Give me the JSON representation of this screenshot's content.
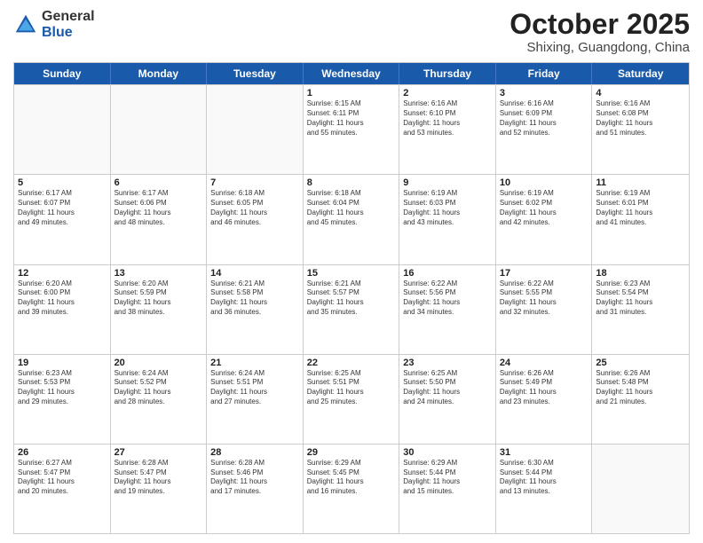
{
  "header": {
    "logo_general": "General",
    "logo_blue": "Blue",
    "month_title": "October 2025",
    "location": "Shixing, Guangdong, China"
  },
  "calendar": {
    "days_of_week": [
      "Sunday",
      "Monday",
      "Tuesday",
      "Wednesday",
      "Thursday",
      "Friday",
      "Saturday"
    ],
    "weeks": [
      [
        {
          "day": "",
          "info": ""
        },
        {
          "day": "",
          "info": ""
        },
        {
          "day": "",
          "info": ""
        },
        {
          "day": "1",
          "info": "Sunrise: 6:15 AM\nSunset: 6:11 PM\nDaylight: 11 hours\nand 55 minutes."
        },
        {
          "day": "2",
          "info": "Sunrise: 6:16 AM\nSunset: 6:10 PM\nDaylight: 11 hours\nand 53 minutes."
        },
        {
          "day": "3",
          "info": "Sunrise: 6:16 AM\nSunset: 6:09 PM\nDaylight: 11 hours\nand 52 minutes."
        },
        {
          "day": "4",
          "info": "Sunrise: 6:16 AM\nSunset: 6:08 PM\nDaylight: 11 hours\nand 51 minutes."
        }
      ],
      [
        {
          "day": "5",
          "info": "Sunrise: 6:17 AM\nSunset: 6:07 PM\nDaylight: 11 hours\nand 49 minutes."
        },
        {
          "day": "6",
          "info": "Sunrise: 6:17 AM\nSunset: 6:06 PM\nDaylight: 11 hours\nand 48 minutes."
        },
        {
          "day": "7",
          "info": "Sunrise: 6:18 AM\nSunset: 6:05 PM\nDaylight: 11 hours\nand 46 minutes."
        },
        {
          "day": "8",
          "info": "Sunrise: 6:18 AM\nSunset: 6:04 PM\nDaylight: 11 hours\nand 45 minutes."
        },
        {
          "day": "9",
          "info": "Sunrise: 6:19 AM\nSunset: 6:03 PM\nDaylight: 11 hours\nand 43 minutes."
        },
        {
          "day": "10",
          "info": "Sunrise: 6:19 AM\nSunset: 6:02 PM\nDaylight: 11 hours\nand 42 minutes."
        },
        {
          "day": "11",
          "info": "Sunrise: 6:19 AM\nSunset: 6:01 PM\nDaylight: 11 hours\nand 41 minutes."
        }
      ],
      [
        {
          "day": "12",
          "info": "Sunrise: 6:20 AM\nSunset: 6:00 PM\nDaylight: 11 hours\nand 39 minutes."
        },
        {
          "day": "13",
          "info": "Sunrise: 6:20 AM\nSunset: 5:59 PM\nDaylight: 11 hours\nand 38 minutes."
        },
        {
          "day": "14",
          "info": "Sunrise: 6:21 AM\nSunset: 5:58 PM\nDaylight: 11 hours\nand 36 minutes."
        },
        {
          "day": "15",
          "info": "Sunrise: 6:21 AM\nSunset: 5:57 PM\nDaylight: 11 hours\nand 35 minutes."
        },
        {
          "day": "16",
          "info": "Sunrise: 6:22 AM\nSunset: 5:56 PM\nDaylight: 11 hours\nand 34 minutes."
        },
        {
          "day": "17",
          "info": "Sunrise: 6:22 AM\nSunset: 5:55 PM\nDaylight: 11 hours\nand 32 minutes."
        },
        {
          "day": "18",
          "info": "Sunrise: 6:23 AM\nSunset: 5:54 PM\nDaylight: 11 hours\nand 31 minutes."
        }
      ],
      [
        {
          "day": "19",
          "info": "Sunrise: 6:23 AM\nSunset: 5:53 PM\nDaylight: 11 hours\nand 29 minutes."
        },
        {
          "day": "20",
          "info": "Sunrise: 6:24 AM\nSunset: 5:52 PM\nDaylight: 11 hours\nand 28 minutes."
        },
        {
          "day": "21",
          "info": "Sunrise: 6:24 AM\nSunset: 5:51 PM\nDaylight: 11 hours\nand 27 minutes."
        },
        {
          "day": "22",
          "info": "Sunrise: 6:25 AM\nSunset: 5:51 PM\nDaylight: 11 hours\nand 25 minutes."
        },
        {
          "day": "23",
          "info": "Sunrise: 6:25 AM\nSunset: 5:50 PM\nDaylight: 11 hours\nand 24 minutes."
        },
        {
          "day": "24",
          "info": "Sunrise: 6:26 AM\nSunset: 5:49 PM\nDaylight: 11 hours\nand 23 minutes."
        },
        {
          "day": "25",
          "info": "Sunrise: 6:26 AM\nSunset: 5:48 PM\nDaylight: 11 hours\nand 21 minutes."
        }
      ],
      [
        {
          "day": "26",
          "info": "Sunrise: 6:27 AM\nSunset: 5:47 PM\nDaylight: 11 hours\nand 20 minutes."
        },
        {
          "day": "27",
          "info": "Sunrise: 6:28 AM\nSunset: 5:47 PM\nDaylight: 11 hours\nand 19 minutes."
        },
        {
          "day": "28",
          "info": "Sunrise: 6:28 AM\nSunset: 5:46 PM\nDaylight: 11 hours\nand 17 minutes."
        },
        {
          "day": "29",
          "info": "Sunrise: 6:29 AM\nSunset: 5:45 PM\nDaylight: 11 hours\nand 16 minutes."
        },
        {
          "day": "30",
          "info": "Sunrise: 6:29 AM\nSunset: 5:44 PM\nDaylight: 11 hours\nand 15 minutes."
        },
        {
          "day": "31",
          "info": "Sunrise: 6:30 AM\nSunset: 5:44 PM\nDaylight: 11 hours\nand 13 minutes."
        },
        {
          "day": "",
          "info": ""
        }
      ]
    ]
  }
}
